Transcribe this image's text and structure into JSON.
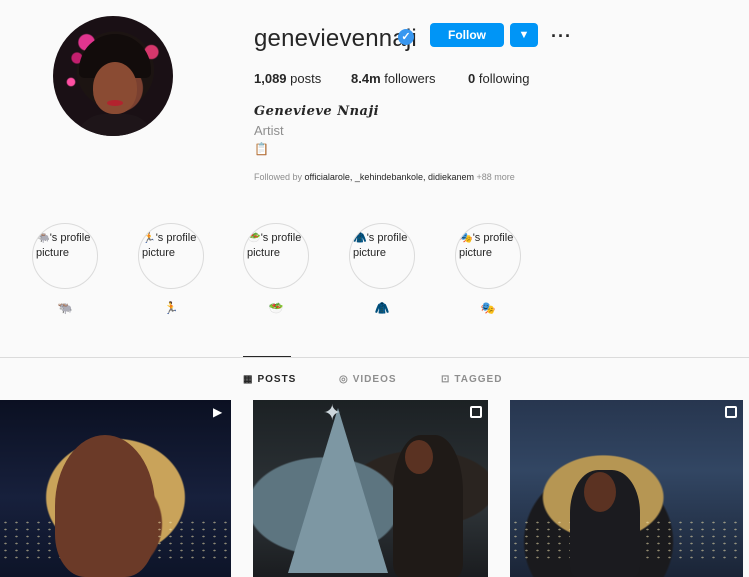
{
  "profile": {
    "username": "genevievennaji",
    "verified_icon": "verified-badge-icon",
    "follow_label": "Follow",
    "dropdown_icon": "chevron-down-icon",
    "more_icon": "more-dots-icon",
    "posts_count": "1,089",
    "posts_label": "posts",
    "followers_count": "8.4m",
    "followers_label": "followers",
    "following_count": "0",
    "following_label": "following",
    "full_name": "𝑮𝒆𝒏𝒆𝒗𝒊𝒆𝒗𝒆 𝑵𝒏𝒂𝒋𝒊",
    "category": "Artist",
    "bio_emoji": "📋",
    "followed_by_prefix": "Followed by",
    "followed_by_names": "officialarole, _kehindebankole, didiekanem",
    "followed_by_more": "+88 more"
  },
  "highlights": [
    {
      "alt": "🐃's profile picture",
      "emoji": "🐃"
    },
    {
      "alt": "🏃's profile picture",
      "emoji": "🏃"
    },
    {
      "alt": "🥗's profile picture",
      "emoji": "🥗"
    },
    {
      "alt": "🧥's profile picture",
      "emoji": "🧥"
    },
    {
      "alt": "🎭's profile picture",
      "emoji": "🎭"
    }
  ],
  "tabs": {
    "posts": "POSTS",
    "videos": "VIDEOS",
    "tagged": "TAGGED"
  },
  "colors": {
    "accent": "#0095f6",
    "verified": "#3897f0",
    "muted_text": "#8e8e8e"
  }
}
